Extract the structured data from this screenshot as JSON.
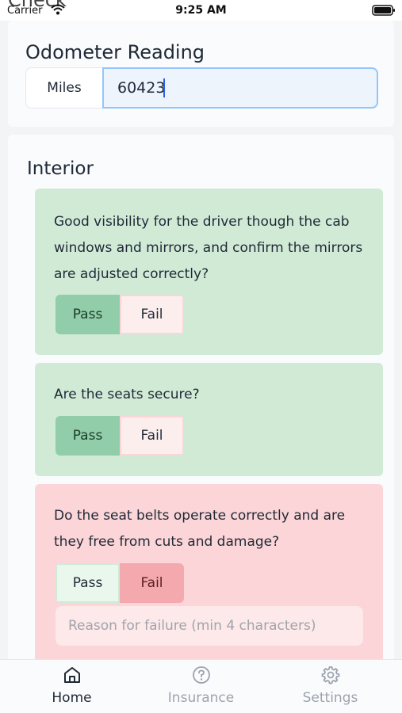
{
  "status_bar": {
    "ghost_title": "Check",
    "carrier": "Carrier",
    "time": "9:25 AM",
    "icons": [
      "wifi-icon",
      "battery-icon"
    ]
  },
  "odometer": {
    "title": "Odometer Reading",
    "unit": "Miles",
    "value": "60423"
  },
  "interior": {
    "title": "Interior",
    "questions": [
      {
        "text": "Good visibility for the driver though the cab windows and mirrors, and confirm the mirrors are adjusted correctly?",
        "pass_label": "Pass",
        "fail_label": "Fail",
        "selected": "Pass"
      },
      {
        "text": "Are the seats secure?",
        "pass_label": "Pass",
        "fail_label": "Fail",
        "selected": "Pass"
      },
      {
        "text": "Do the seat belts operate correctly and are they free from cuts and damage?",
        "pass_label": "Pass",
        "fail_label": "Fail",
        "selected": "Fail",
        "reason_placeholder": "Reason for failure (min 4 characters)"
      }
    ]
  },
  "tab_bar": {
    "tabs": [
      {
        "label": "Home",
        "icon": "home-icon",
        "active": true
      },
      {
        "label": "Insurance",
        "icon": "question-circle-icon",
        "active": false
      },
      {
        "label": "Settings",
        "icon": "gear-icon",
        "active": false
      }
    ]
  },
  "colors": {
    "pass_card": "#d1ead6",
    "fail_card": "#fbd5d7",
    "pass_active": "#90cda8",
    "fail_active": "#f3a9ad",
    "input_focus_border": "#93c5fd"
  }
}
